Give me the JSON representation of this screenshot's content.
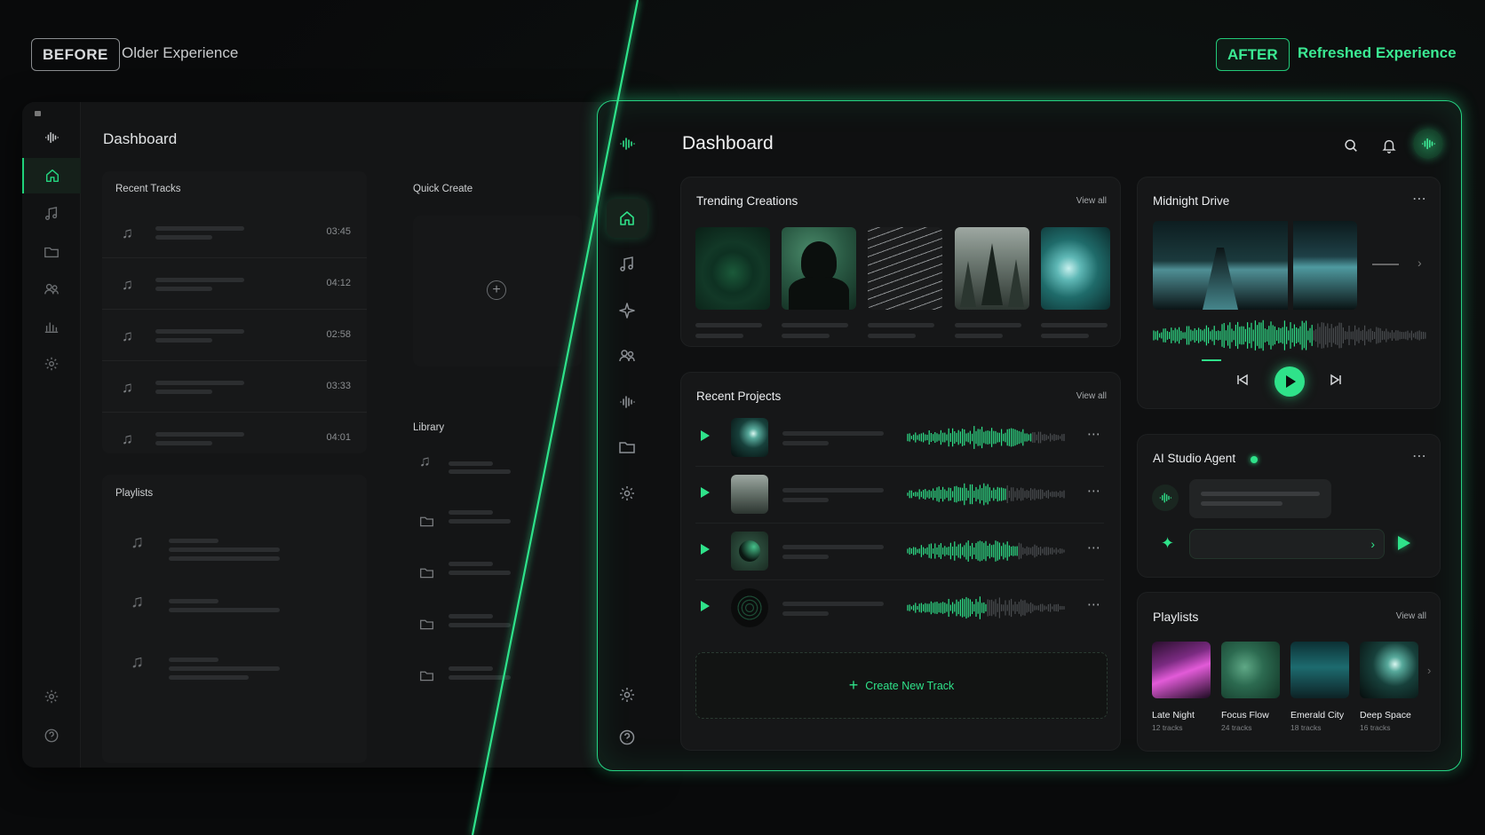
{
  "labels": {
    "before_tag": "BEFORE",
    "before_sub": "Older Experience",
    "after_tag": "AFTER",
    "after_sub": "Refreshed Experience"
  },
  "before": {
    "title": "Dashboard",
    "recent_tracks_title": "Recent Tracks",
    "quick_create_title": "Quick Create",
    "library_title": "Library",
    "playlists_title": "Playlists",
    "tracks": [
      {
        "time": "03:45"
      },
      {
        "time": "04:12"
      },
      {
        "time": "02:58"
      },
      {
        "time": "03:33"
      },
      {
        "time": "04:01"
      }
    ]
  },
  "after": {
    "title": "Dashboard",
    "trending_title": "Trending Creations",
    "recent_projects_title": "Recent Projects",
    "view_all": "View all",
    "player_title": "Midnight Drive",
    "agent_title": "AI Studio Agent",
    "create_new_track": "Create New Track",
    "playlists_title": "Playlists",
    "playlists": [
      {
        "name": "Late Night",
        "tracks": "12 tracks"
      },
      {
        "name": "Focus Flow",
        "tracks": "24 tracks"
      },
      {
        "name": "Emerald City",
        "tracks": "18 tracks"
      },
      {
        "name": "Deep Space",
        "tracks": "16 tracks"
      }
    ]
  },
  "colors": {
    "accent": "#2fe28a",
    "panel": "#0f1011",
    "before_panel": "#141516"
  },
  "icons": {
    "old_sidebar": [
      "waveform-icon",
      "home-icon",
      "music-note-icon",
      "folder-icon",
      "users-icon",
      "bar-chart-icon",
      "gear-icon",
      "settings-icon",
      "help-icon"
    ],
    "new_sidebar": [
      "waveform-icon",
      "home-icon",
      "music-note-icon",
      "sparkle-icon",
      "users-icon",
      "waveform-icon",
      "folder-icon",
      "gear-icon",
      "gear-icon",
      "help-icon"
    ]
  }
}
